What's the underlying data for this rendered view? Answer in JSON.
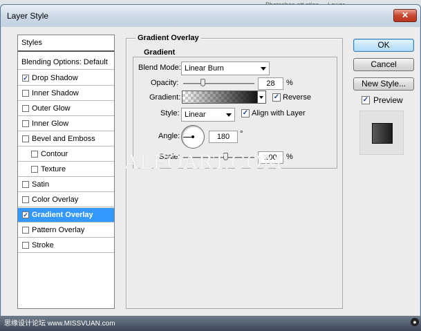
{
  "window": {
    "title": "Layer Style",
    "close_glyph": "✕"
  },
  "background": {
    "text": "Photoshop    ntt    ption ... Lower"
  },
  "styles_list": {
    "header": "Styles",
    "blending": "Blending Options: Default",
    "items": [
      {
        "label": "Drop Shadow",
        "checked": true
      },
      {
        "label": "Inner Shadow",
        "checked": false
      },
      {
        "label": "Outer Glow",
        "checked": false
      },
      {
        "label": "Inner Glow",
        "checked": false
      },
      {
        "label": "Bevel and Emboss",
        "checked": false
      },
      {
        "label": "Contour",
        "checked": false
      },
      {
        "label": "Texture",
        "checked": false
      },
      {
        "label": "Satin",
        "checked": false
      },
      {
        "label": "Color Overlay",
        "checked": false
      },
      {
        "label": "Gradient Overlay",
        "checked": true
      },
      {
        "label": "Pattern Overlay",
        "checked": false
      },
      {
        "label": "Stroke",
        "checked": false
      }
    ],
    "selected": "Gradient Overlay"
  },
  "panel": {
    "title": "Gradient Overlay",
    "group_title": "Gradient",
    "blend_mode_label": "Blend Mode:",
    "blend_mode_value": "Linear Burn",
    "opacity_label": "Opacity:",
    "opacity_value": "28",
    "opacity_unit": "%",
    "opacity_fraction": 0.28,
    "gradient_label": "Gradient:",
    "reverse_label": "Reverse",
    "reverse_checked": true,
    "style_label": "Style:",
    "style_value": "Linear",
    "align_label": "Align with Layer",
    "align_checked": true,
    "angle_label": "Angle:",
    "angle_value": "180",
    "angle_unit": "°",
    "scale_label": "Scale:",
    "scale_value": "100",
    "scale_unit": "%",
    "scale_fraction": 1.0
  },
  "buttons": {
    "ok": "OK",
    "cancel": "Cancel",
    "new_style": "New Style...",
    "preview_label": "Preview",
    "preview_checked": true
  },
  "watermark": "ALFOART.COM",
  "footer": {
    "text": "思缘设计论坛 www.MISSVUAN.com"
  },
  "colors": {
    "selected": "#3399ff",
    "accent": "#1b3f91"
  }
}
